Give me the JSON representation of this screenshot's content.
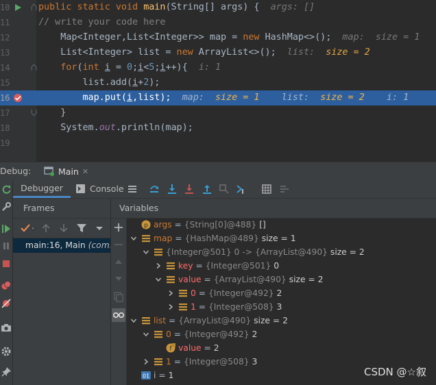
{
  "editor": {
    "lines": [
      {
        "num": "10",
        "parts": [
          {
            "c": "kw",
            "t": "public "
          },
          {
            "c": "kw",
            "t": "static "
          },
          {
            "c": "kw",
            "t": "void "
          },
          {
            "c": "fn",
            "t": "main"
          },
          {
            "c": "pl",
            "t": "(String[] args) {  "
          },
          {
            "c": "hint-k",
            "t": "args: []"
          }
        ]
      },
      {
        "num": "11",
        "parts": [
          {
            "c": "cmt",
            "t": "// write your code here"
          }
        ]
      },
      {
        "num": "12",
        "parts": [
          {
            "c": "pl",
            "t": "    Map<Integer,List<Integer>> map = "
          },
          {
            "c": "kw",
            "t": "new "
          },
          {
            "c": "pl",
            "t": "HashMap<>();  "
          },
          {
            "c": "hint-k",
            "t": "map:  size = 1"
          }
        ]
      },
      {
        "num": "13",
        "parts": [
          {
            "c": "pl",
            "t": "    List<Integer> list = "
          },
          {
            "c": "kw",
            "t": "new "
          },
          {
            "c": "pl",
            "t": "ArrayList<>();  "
          },
          {
            "c": "hint-k",
            "t": "list:  "
          },
          {
            "c": "hint-v",
            "t": "size = 2"
          }
        ]
      },
      {
        "num": "14",
        "parts": [
          {
            "c": "pl",
            "t": "    "
          },
          {
            "c": "kw",
            "t": "for"
          },
          {
            "c": "pl",
            "t": "("
          },
          {
            "c": "kw",
            "t": "int "
          },
          {
            "c": "pl ul",
            "t": "i"
          },
          {
            "c": "pl",
            "t": " = "
          },
          {
            "c": "num",
            "t": "0"
          },
          {
            "c": "pl",
            "t": ";"
          },
          {
            "c": "pl ul",
            "t": "i"
          },
          {
            "c": "pl",
            "t": "<"
          },
          {
            "c": "num",
            "t": "5"
          },
          {
            "c": "pl",
            "t": ";"
          },
          {
            "c": "pl ul",
            "t": "i"
          },
          {
            "c": "pl",
            "t": "++){  "
          },
          {
            "c": "hint-k",
            "t": "i: 1"
          }
        ]
      },
      {
        "num": "15",
        "parts": [
          {
            "c": "pl",
            "t": "        list.add("
          },
          {
            "c": "pl ul",
            "t": "i"
          },
          {
            "c": "pl",
            "t": "+"
          },
          {
            "c": "num",
            "t": "2"
          },
          {
            "c": "pl",
            "t": ");"
          }
        ]
      },
      {
        "num": "16",
        "parts": [
          {
            "c": "pl",
            "t": "        map.put("
          },
          {
            "c": "pl ul",
            "t": "i"
          },
          {
            "c": "pl",
            "t": ",list);  "
          },
          {
            "c": "hint-k",
            "t": "map:  "
          },
          {
            "c": "hint-v",
            "t": "size = 1"
          },
          {
            "c": "hint-k",
            "t": "    list:  "
          },
          {
            "c": "hint-v",
            "t": "size = 2"
          },
          {
            "c": "hint-k",
            "t": "    i: 1"
          }
        ]
      },
      {
        "num": "17",
        "parts": [
          {
            "c": "pl",
            "t": "    }"
          }
        ]
      },
      {
        "num": "18",
        "parts": [
          {
            "c": "pl",
            "t": "    System."
          },
          {
            "c": "fld",
            "t": "out"
          },
          {
            "c": "pl",
            "t": ".println(map);"
          }
        ]
      },
      {
        "num": "19",
        "parts": []
      }
    ]
  },
  "debug": {
    "label": "Debug:",
    "tab": "Main"
  },
  "tabs": {
    "debugger": "Debugger",
    "console": "Console"
  },
  "frames": {
    "title": "Frames",
    "row_location": "main:16, Main ",
    "row_package": "(com.e"
  },
  "variables": {
    "title": "Variables",
    "rows": [
      {
        "indent": 0,
        "arrow": "",
        "icon": "p",
        "name": "args",
        "ref": "{String[0]@488}",
        "val": "[]"
      },
      {
        "indent": 0,
        "arrow": "down",
        "icon": "list",
        "name": "map",
        "ref": "{HashMap@489}",
        "val": "size = 1"
      },
      {
        "indent": 1,
        "arrow": "down",
        "icon": "list",
        "name": "",
        "ref": "{Integer@501} 0 -> {ArrayList@490}",
        "val": "size = 2"
      },
      {
        "indent": 2,
        "arrow": "right",
        "icon": "list",
        "name": "key",
        "ref": "{Integer@501}",
        "val": "0",
        "hl": true
      },
      {
        "indent": 2,
        "arrow": "down",
        "icon": "list",
        "name": "value",
        "ref": "{ArrayList@490}",
        "val": "size = 2",
        "hl": true
      },
      {
        "indent": 3,
        "arrow": "right",
        "icon": "list",
        "name": "0",
        "ref": "{Integer@492}",
        "val": "2",
        "hl": true
      },
      {
        "indent": 3,
        "arrow": "right",
        "icon": "list",
        "name": "1",
        "ref": "{Integer@508}",
        "val": "3",
        "hl": true
      },
      {
        "indent": 0,
        "arrow": "down",
        "icon": "list",
        "name": "list",
        "ref": "{ArrayList@490}",
        "val": "size = 2"
      },
      {
        "indent": 1,
        "arrow": "down",
        "icon": "list",
        "name": "0",
        "ref": "{Integer@492}",
        "val": "2"
      },
      {
        "indent": 2,
        "arrow": "",
        "icon": "f",
        "name": "value",
        "ref": "",
        "val": "2",
        "hl": true
      },
      {
        "indent": 1,
        "arrow": "right",
        "icon": "list",
        "name": "1",
        "ref": "{Integer@508}",
        "val": "3"
      },
      {
        "indent": 0,
        "arrow": "",
        "icon": "i",
        "name": "i",
        "ref": "",
        "val": "1",
        "plain": true
      }
    ]
  },
  "watermark": "CSDN @☆叙"
}
